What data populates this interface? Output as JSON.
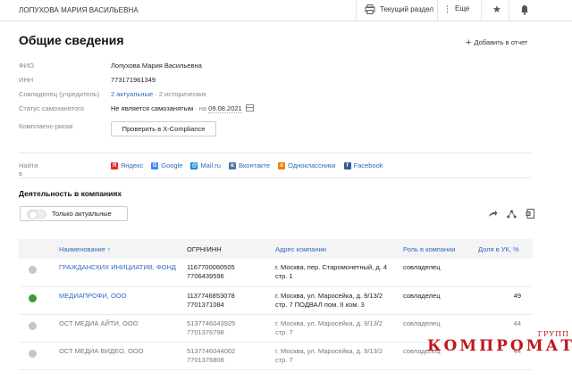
{
  "topbar": {
    "person": "ЛОПУХОВА МАРИЯ ВАСИЛЬЕВНА",
    "section_label": "Текущий раздел",
    "more_label": "Еще"
  },
  "page": {
    "title": "Общие сведения",
    "add_report": "Добавить в отчет"
  },
  "info": {
    "fio_label": "ФИО",
    "fio_value": "Лопухова Мария Васильевна",
    "inn_label": "ИНН",
    "inn_value": "773171961349",
    "owner_label": "Совладелец (учредитель)",
    "owner_actual": "2 актуальные",
    "owner_hist": " · 2 исторических",
    "self_label": "Статус самозанятого",
    "self_value": "Не является самозанятым",
    "self_na": " · на ",
    "self_date": "09.08.2021",
    "compliance_label": "Комплаенс-риски",
    "compliance_btn": "Проверить в X-Compliance"
  },
  "find": {
    "label": "Найти в",
    "links": [
      {
        "name": "Яндекс",
        "icon": "yandex-icon",
        "color": "#e52620",
        "glyph": "Я"
      },
      {
        "name": "Google",
        "icon": "google-icon",
        "color": "#4285f4",
        "glyph": "G"
      },
      {
        "name": "Mail.ru",
        "icon": "mailru-icon",
        "color": "#168de2",
        "glyph": "@"
      },
      {
        "name": "Вконтакте",
        "icon": "vk-icon",
        "color": "#4a76a8",
        "glyph": "в"
      },
      {
        "name": "Одноклассники",
        "icon": "ok-icon",
        "color": "#f2800a",
        "glyph": "о"
      },
      {
        "name": "Facebook",
        "icon": "facebook-icon",
        "color": "#3b5998",
        "glyph": "f"
      }
    ]
  },
  "activity": {
    "title": "Деятельность в компаниях",
    "toggle_label": "Только актуальные"
  },
  "table": {
    "headers": {
      "name": "Наименование ↑",
      "ogrn": "ОГРН/ИНН",
      "address": "Адрес компании",
      "role": "Роль в компании",
      "share": "Доля в УК, %"
    },
    "rows": [
      {
        "status": "gray",
        "name": "ГРАЖДАНСКИХ ИНИЦИАТИВ, ФОНД",
        "name_link": true,
        "ogrn": "1167700060505",
        "inn": "7706439596",
        "addr1": "г. Москва, пер. Старомонетный, д. 4",
        "addr2": "стр. 1",
        "role": "совладелец",
        "share": "",
        "dim": false
      },
      {
        "status": "green",
        "name": "МЕДИАПРОФИ, ООО",
        "name_link": true,
        "ogrn": "1137746853078",
        "inn": "7701371084",
        "addr1": "г. Москва, ул. Маросейка, д. 9/13/2",
        "addr2": "стр. 7 ПОДВАЛ пом. II ком. 3",
        "role": "совладелец",
        "share": "49",
        "dim": false
      },
      {
        "status": "gray",
        "name": "ОСТ МЕДИА АЙТИ, ООО",
        "name_link": false,
        "ogrn": "5137746043925",
        "inn": "7701376798",
        "addr1": "г. Москва, ул. Маросейка, д. 9/13/2",
        "addr2": "стр. 7",
        "role": "совладелец",
        "share": "44",
        "dim": true
      },
      {
        "status": "gray",
        "name": "ОСТ МЕДИА ВИДЕО, ООО",
        "name_link": false,
        "ogrn": "5137746044002",
        "inn": "7701376808",
        "addr1": "г. Москва, ул. Маросейка, д. 9/13/2",
        "addr2": "стр. 7",
        "role": "совладелец",
        "share": "44",
        "dim": true
      }
    ]
  },
  "watermark": {
    "big": "КОМПРОМАТ",
    "small": "ГРУПП"
  }
}
